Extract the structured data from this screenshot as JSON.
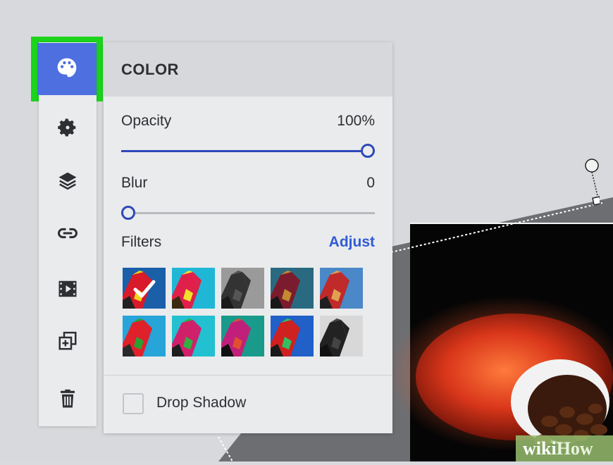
{
  "panel": {
    "title": "COLOR",
    "opacity": {
      "label": "Opacity",
      "value": "100%",
      "level": 1.0
    },
    "blur": {
      "label": "Blur",
      "value": "0",
      "level": 0.0
    },
    "filters": {
      "label": "Filters",
      "action": "Adjust"
    },
    "drop_shadow": {
      "label": "Drop Shadow",
      "checked": false
    }
  },
  "toolbar": {
    "items": [
      "palette-icon",
      "gear-icon",
      "layers-icon",
      "link-icon",
      "film-icon",
      "duplicate-icon",
      "trash-icon"
    ],
    "active": "palette-icon"
  },
  "filter_thumbnails": {
    "count": 10,
    "selected_index": 0
  },
  "watermark": {
    "part1": "wiki",
    "part2": "How"
  },
  "colors": {
    "accent": "#2f49b8",
    "link": "#2f5bd6",
    "active_tool": "#4d6fe0",
    "highlight_frame": "#1bd41b"
  }
}
